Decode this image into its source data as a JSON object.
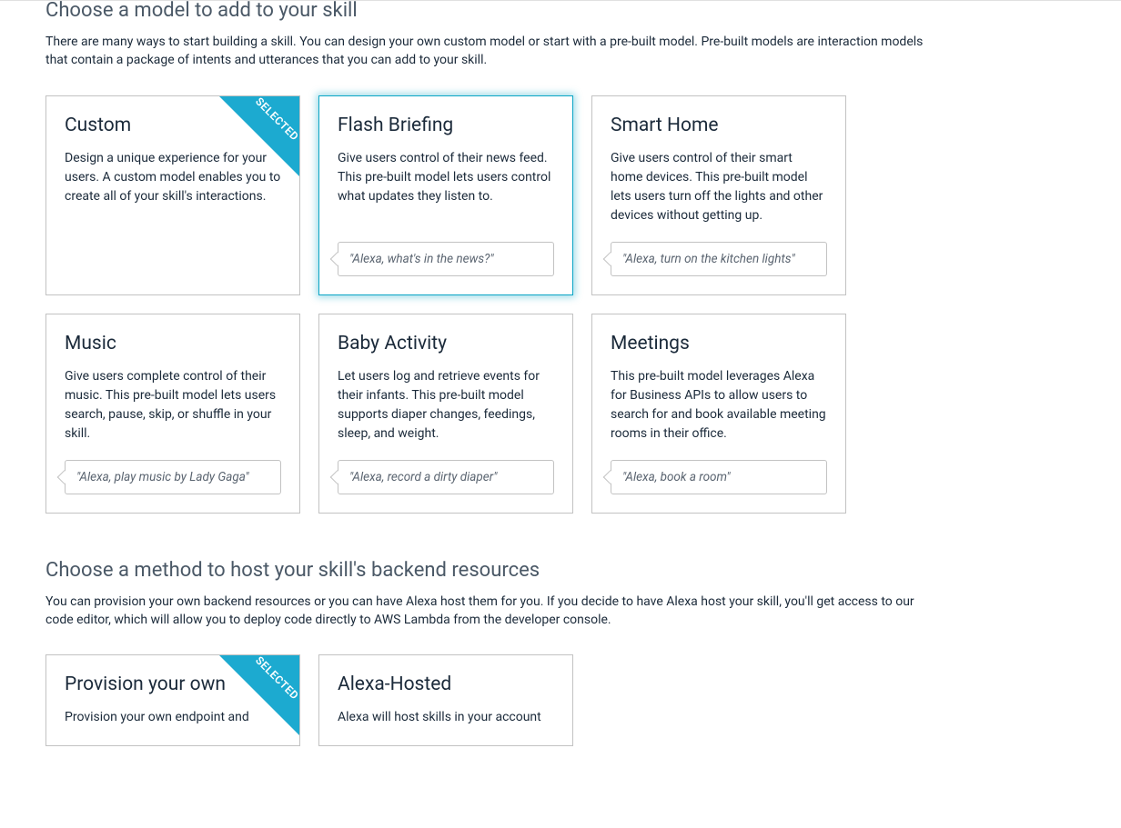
{
  "section_model": {
    "title": "Choose a model to add to your skill",
    "desc": "There are many ways to start building a skill. You can design your own custom model or start with a pre-built model.  Pre-built models are interaction models that contain a package of intents and utterances that you can add to your skill.",
    "selected_label": "SELECTED",
    "cards": {
      "custom": {
        "title": "Custom",
        "desc": "Design a unique experience for your users. A custom model enables you to create all of your skill's interactions."
      },
      "flash_briefing": {
        "title": "Flash Briefing",
        "desc": "Give users control of their news feed. This pre-built model lets users control what updates they listen to.",
        "example": "\"Alexa, what's in the news?\""
      },
      "smart_home": {
        "title": "Smart Home",
        "desc": "Give users control of their smart home devices. This pre-built model lets users turn off the lights and other devices without getting up.",
        "example": "\"Alexa, turn on the kitchen lights\""
      },
      "music": {
        "title": "Music",
        "desc": "Give users complete control of their music. This pre-built model lets users search, pause, skip, or shuffle in your skill.",
        "example": "\"Alexa, play music by Lady Gaga\""
      },
      "baby_activity": {
        "title": "Baby Activity",
        "desc": "Let users log and retrieve events for their infants. This pre-built model supports diaper changes, feedings, sleep, and weight.",
        "example": "\"Alexa, record a dirty diaper\""
      },
      "meetings": {
        "title": "Meetings",
        "desc": "This pre-built model leverages Alexa for Business APIs to allow users to search for and book available meeting rooms in their office.",
        "example": "\"Alexa, book a room\""
      }
    }
  },
  "section_host": {
    "title": "Choose a method to host your skill's backend resources",
    "desc": "You can provision your own backend resources or you can have Alexa host them for you. If you decide to have Alexa host your skill, you'll get access to our code editor, which will allow you to deploy code directly to AWS Lambda from the developer console.",
    "selected_label": "SELECTED",
    "cards": {
      "provision": {
        "title": "Provision your own",
        "desc": "Provision your own endpoint and"
      },
      "alexa_hosted": {
        "title": "Alexa-Hosted",
        "desc": "Alexa will host skills in your account"
      }
    }
  }
}
